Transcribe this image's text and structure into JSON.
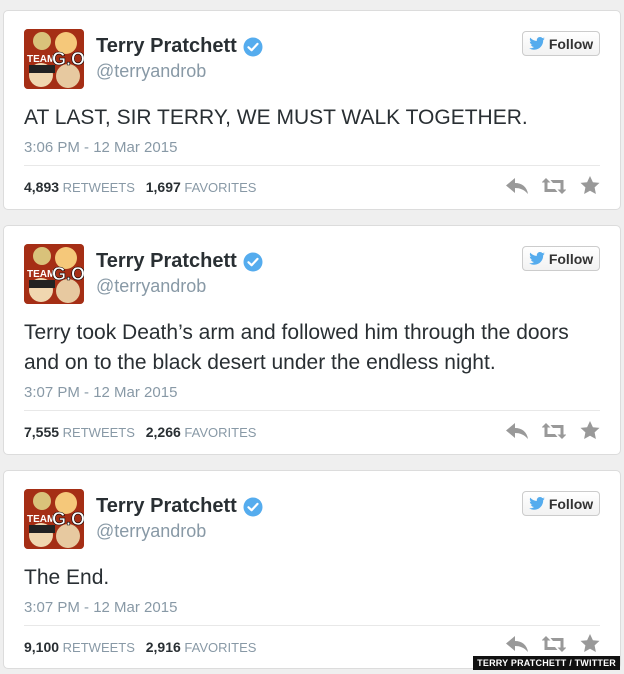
{
  "colors": {
    "twitter_blue": "#55acee",
    "muted": "#8899a6",
    "text": "#292f33",
    "action_gray": "#999999"
  },
  "icons": {
    "verified": "verified-badge-icon",
    "follow": "twitter-bird-icon",
    "reply": "reply-icon",
    "retweet": "retweet-icon",
    "favorite": "star-icon"
  },
  "avatar": {
    "text": "TEAMG.O."
  },
  "tweets": [
    {
      "name": "Terry Pratchett",
      "handle": "@terryandrob",
      "follow_label": "Follow",
      "text": "AT LAST, SIR TERRY, WE MUST WALK TOGETHER.",
      "time": "3:06 PM - 12 Mar 2015",
      "retweets": "4,893",
      "retweets_label": "RETWEETS",
      "favorites": "1,697",
      "favorites_label": "FAVORITES"
    },
    {
      "name": "Terry Pratchett",
      "handle": "@terryandrob",
      "follow_label": "Follow",
      "text": "Terry took Death’s arm and followed him through the doors and on to the black desert under the endless night.",
      "time": "3:07 PM - 12 Mar 2015",
      "retweets": "7,555",
      "retweets_label": "RETWEETS",
      "favorites": "2,266",
      "favorites_label": "FAVORITES"
    },
    {
      "name": "Terry Pratchett",
      "handle": "@terryandrob",
      "follow_label": "Follow",
      "text": "The End.",
      "time": "3:07 PM - 12 Mar 2015",
      "retweets": "9,100",
      "retweets_label": "RETWEETS",
      "favorites": "2,916",
      "favorites_label": "FAVORITES"
    }
  ],
  "credit": "TERRY PRATCHETT / TWITTER"
}
